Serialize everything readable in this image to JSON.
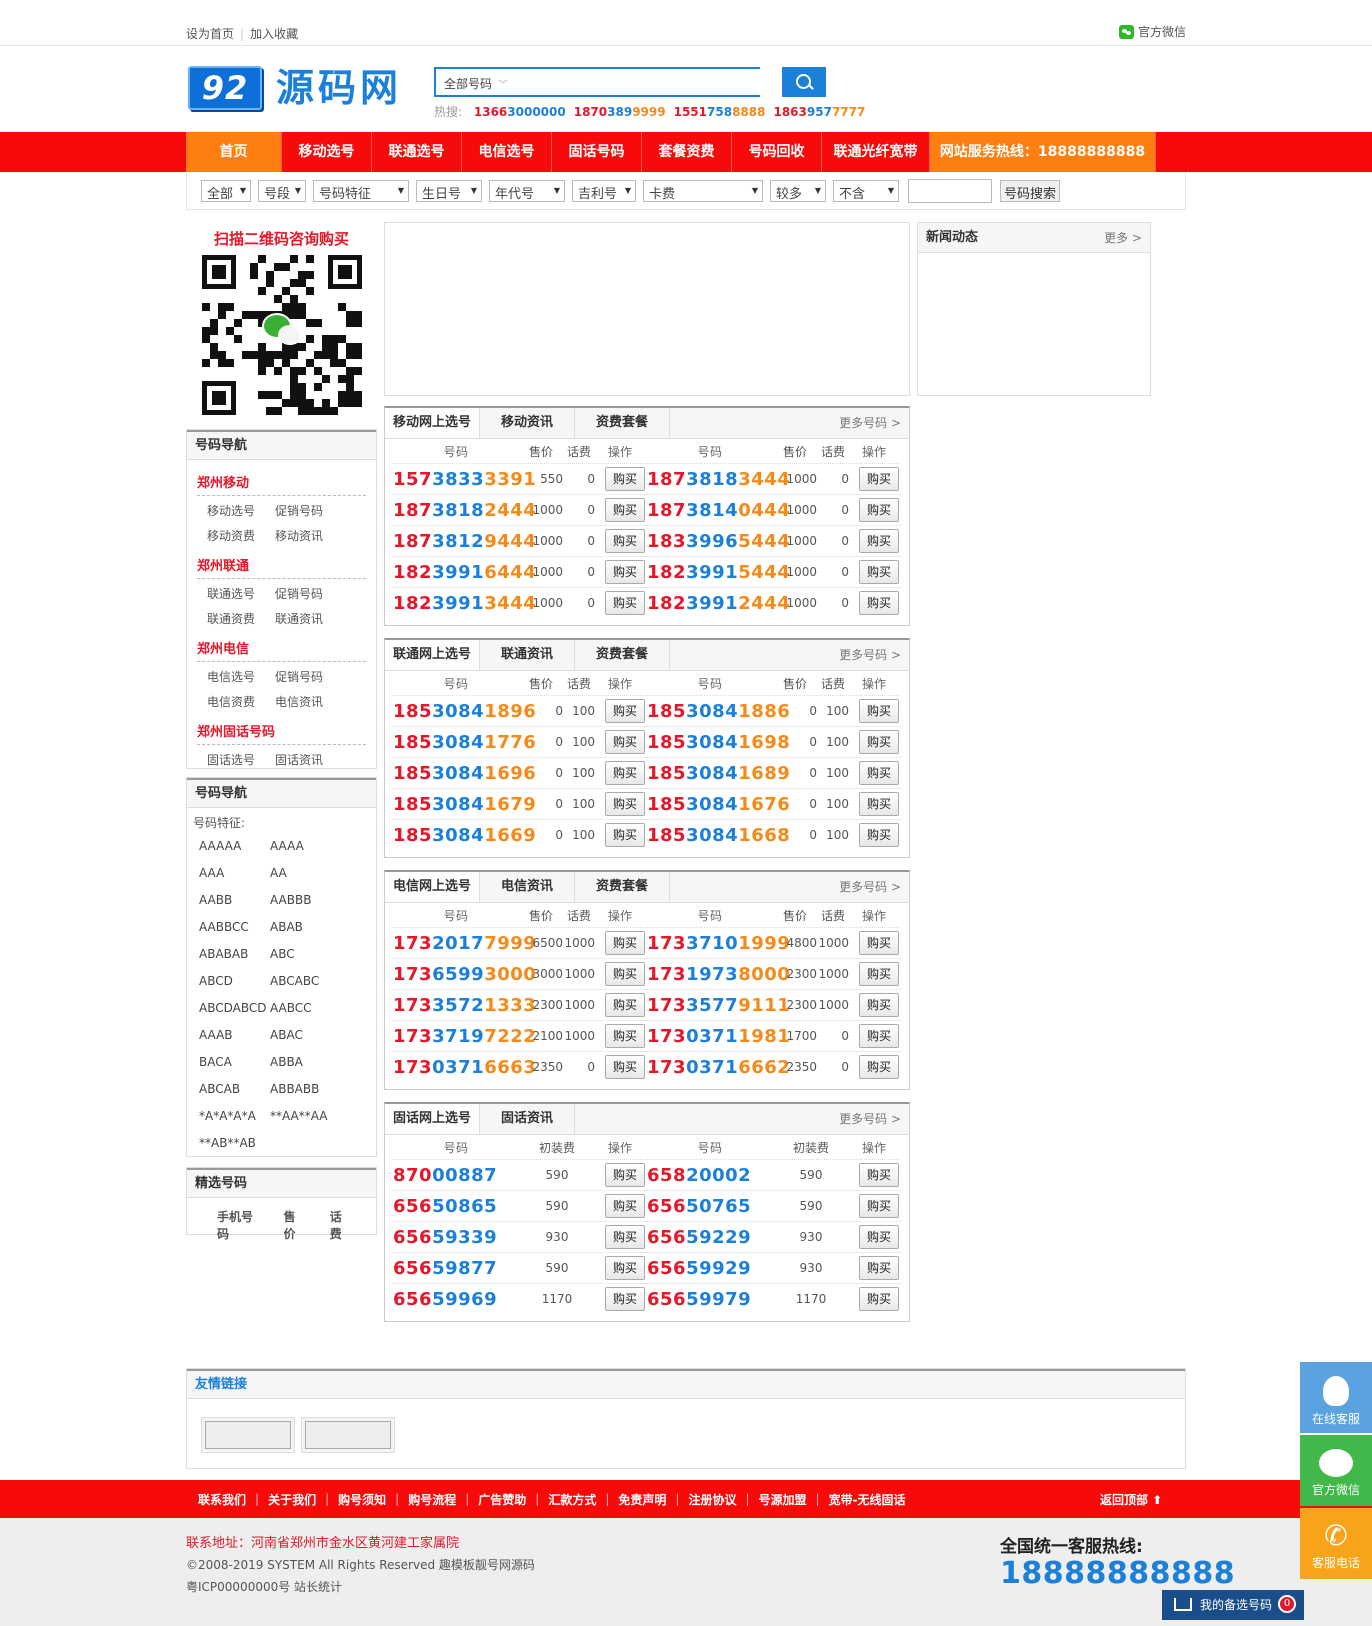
{
  "topbar": {
    "set_home": "设为首页",
    "favorite": "加入收藏",
    "wechat": "官方微信"
  },
  "header": {
    "logo_num": "92",
    "logo_text": "源码网",
    "search_select": "全部号码",
    "hot_label": "热搜:",
    "hot": [
      {
        "a": "1366",
        "b": "3000000",
        "c": ""
      },
      {
        "a": "1870",
        "b": "389",
        "c": "9999"
      },
      {
        "a": "1551",
        "b": "758",
        "c": "8888"
      },
      {
        "a": "1863",
        "b": "957",
        "c": "7777"
      }
    ]
  },
  "nav": [
    "首页",
    "移动选号",
    "联通选号",
    "电信选号",
    "固话号码",
    "套餐资费",
    "号码回收",
    "联通光纤宽带",
    "网站服务热线：18888888888"
  ],
  "filter": {
    "selects": [
      "全部",
      "号段",
      "号码特征",
      "生日号",
      "年代号",
      "吉利号",
      "卡费",
      "较多",
      "不含"
    ],
    "search_btn": "号码搜索"
  },
  "qr_title": "扫描二维码咨询购买",
  "navbox": {
    "title": "号码导航",
    "sections": [
      {
        "cat": "郑州移动",
        "links": [
          "移动选号",
          "促销号码",
          "移动资费",
          "移动资讯"
        ]
      },
      {
        "cat": "郑州联通",
        "links": [
          "联通选号",
          "促销号码",
          "联通资费",
          "联通资讯"
        ]
      },
      {
        "cat": "郑州电信",
        "links": [
          "电信选号",
          "促销号码",
          "电信资费",
          "电信资讯"
        ]
      },
      {
        "cat": "郑州固话号码",
        "links": [
          "固话选号",
          "固话资讯"
        ]
      }
    ]
  },
  "featbox": {
    "title": "号码导航",
    "label": "号码特征:",
    "items": [
      "AAAAA",
      "AAAA",
      "AAA",
      "AA",
      "AABB",
      "AABBB",
      "AABBCC",
      "ABAB",
      "ABABAB",
      "ABC",
      "ABCD",
      "ABCABC",
      "ABCDABCD",
      "AABCC",
      "AAAB",
      "ABAC",
      "BACA",
      "ABBA",
      "ABCAB",
      "ABBABB",
      "*A*A*A*A",
      "**AA**AA",
      "**AB**AB"
    ]
  },
  "pickbox": {
    "title": "精选号码",
    "cols": [
      "手机号码",
      "售价",
      "话费"
    ]
  },
  "news": {
    "title": "新闻动态",
    "more": "更多 >"
  },
  "panels": [
    {
      "tabs": [
        "移动网上选号",
        "移动资讯",
        "资费套餐"
      ],
      "more": "更多号码 >",
      "cols": [
        "号码",
        "售价",
        "话费",
        "操作"
      ],
      "rows": [
        [
          {
            "a": "157",
            "b": "3833",
            "c": "3391",
            "p": "550",
            "f": "0"
          },
          {
            "a": "187",
            "b": "3818",
            "c": "3444",
            "p": "1000",
            "f": "0"
          }
        ],
        [
          {
            "a": "187",
            "b": "3818",
            "c": "2444",
            "p": "1000",
            "f": "0"
          },
          {
            "a": "187",
            "b": "3814",
            "c": "0444",
            "p": "1000",
            "f": "0"
          }
        ],
        [
          {
            "a": "187",
            "b": "3812",
            "c": "9444",
            "p": "1000",
            "f": "0"
          },
          {
            "a": "183",
            "b": "3996",
            "c": "5444",
            "p": "1000",
            "f": "0"
          }
        ],
        [
          {
            "a": "182",
            "b": "3991",
            "c": "6444",
            "p": "1000",
            "f": "0"
          },
          {
            "a": "182",
            "b": "3991",
            "c": "5444",
            "p": "1000",
            "f": "0"
          }
        ],
        [
          {
            "a": "182",
            "b": "3991",
            "c": "3444",
            "p": "1000",
            "f": "0"
          },
          {
            "a": "182",
            "b": "3991",
            "c": "2444",
            "p": "1000",
            "f": "0"
          }
        ]
      ]
    },
    {
      "tabs": [
        "联通网上选号",
        "联通资讯",
        "资费套餐"
      ],
      "more": "更多号码 >",
      "cols": [
        "号码",
        "售价",
        "话费",
        "操作"
      ],
      "rows": [
        [
          {
            "a": "185",
            "b": "3084",
            "c": "1896",
            "p": "0",
            "f": "100"
          },
          {
            "a": "185",
            "b": "3084",
            "c": "1886",
            "p": "0",
            "f": "100"
          }
        ],
        [
          {
            "a": "185",
            "b": "3084",
            "c": "1776",
            "p": "0",
            "f": "100"
          },
          {
            "a": "185",
            "b": "3084",
            "c": "1698",
            "p": "0",
            "f": "100"
          }
        ],
        [
          {
            "a": "185",
            "b": "3084",
            "c": "1696",
            "p": "0",
            "f": "100"
          },
          {
            "a": "185",
            "b": "3084",
            "c": "1689",
            "p": "0",
            "f": "100"
          }
        ],
        [
          {
            "a": "185",
            "b": "3084",
            "c": "1679",
            "p": "0",
            "f": "100"
          },
          {
            "a": "185",
            "b": "3084",
            "c": "1676",
            "p": "0",
            "f": "100"
          }
        ],
        [
          {
            "a": "185",
            "b": "3084",
            "c": "1669",
            "p": "0",
            "f": "100"
          },
          {
            "a": "185",
            "b": "3084",
            "c": "1668",
            "p": "0",
            "f": "100"
          }
        ]
      ]
    },
    {
      "tabs": [
        "电信网上选号",
        "电信资讯",
        "资费套餐"
      ],
      "more": "更多号码 >",
      "cols": [
        "号码",
        "售价",
        "话费",
        "操作"
      ],
      "rows": [
        [
          {
            "a": "173",
            "b": "2017",
            "c": "7999",
            "p": "6500",
            "f": "1000"
          },
          {
            "a": "173",
            "b": "3710",
            "c": "1999",
            "p": "4800",
            "f": "1000"
          }
        ],
        [
          {
            "a": "173",
            "b": "6599",
            "c": "3000",
            "p": "3000",
            "f": "1000"
          },
          {
            "a": "173",
            "b": "1973",
            "c": "8000",
            "p": "2300",
            "f": "1000"
          }
        ],
        [
          {
            "a": "173",
            "b": "3572",
            "c": "1333",
            "p": "2300",
            "f": "1000"
          },
          {
            "a": "173",
            "b": "3577",
            "c": "9111",
            "p": "2300",
            "f": "1000"
          }
        ],
        [
          {
            "a": "173",
            "b": "3719",
            "c": "7222",
            "p": "2100",
            "f": "1000"
          },
          {
            "a": "173",
            "b": "0371",
            "c": "1981",
            "p": "1700",
            "f": "0"
          }
        ],
        [
          {
            "a": "173",
            "b": "0371",
            "c": "6663",
            "p": "2350",
            "f": "0"
          },
          {
            "a": "173",
            "b": "0371",
            "c": "6662",
            "p": "2350",
            "f": "0"
          }
        ]
      ]
    },
    {
      "tabs": [
        "固话网上选号",
        "固话资讯"
      ],
      "more": "更多号码 >",
      "cols": [
        "号码",
        "初装费",
        "操作"
      ],
      "rows": [
        [
          {
            "a": "870",
            "b": "00887",
            "p": "590"
          },
          {
            "a": "658",
            "b": "20002",
            "p": "590"
          }
        ],
        [
          {
            "a": "656",
            "b": "50865",
            "p": "590"
          },
          {
            "a": "656",
            "b": "50765",
            "p": "590"
          }
        ],
        [
          {
            "a": "656",
            "b": "59339",
            "p": "930"
          },
          {
            "a": "656",
            "b": "59229",
            "p": "930"
          }
        ],
        [
          {
            "a": "656",
            "b": "59877",
            "p": "590"
          },
          {
            "a": "656",
            "b": "59929",
            "p": "930"
          }
        ],
        [
          {
            "a": "656",
            "b": "59969",
            "p": "1170"
          },
          {
            "a": "656",
            "b": "59979",
            "p": "1170"
          }
        ]
      ]
    }
  ],
  "buy_label": "购买",
  "links": {
    "title": "友情链接"
  },
  "footer_nav": [
    "联系我们",
    "关于我们",
    "购号须知",
    "购号流程",
    "广告赞助",
    "汇款方式",
    "免责声明",
    "注册协议",
    "号源加盟",
    "宽带-无线固话"
  ],
  "back_top": "返回顶部",
  "footer": {
    "addr": "联系地址：河南省郑州市金水区黄河建工家属院",
    "copy": "©2008-2019 SYSTEM All Rights Reserved 趣模板靓号网源码",
    "icp": "粤ICP00000000号 站长统计",
    "hotline_title": "全国统一客服热线:",
    "hotline_num": "18888888888"
  },
  "side": [
    {
      "label": "在线客服",
      "icon": "qq-icon",
      "color": "#5aa3e0"
    },
    {
      "label": "官方微信",
      "icon": "wechat-icon",
      "color": "#43b84a"
    },
    {
      "label": "客服电话",
      "icon": "phone-icon",
      "color": "#f7a41c"
    }
  ],
  "cart": {
    "label": "我的备选号码",
    "count": "0"
  }
}
